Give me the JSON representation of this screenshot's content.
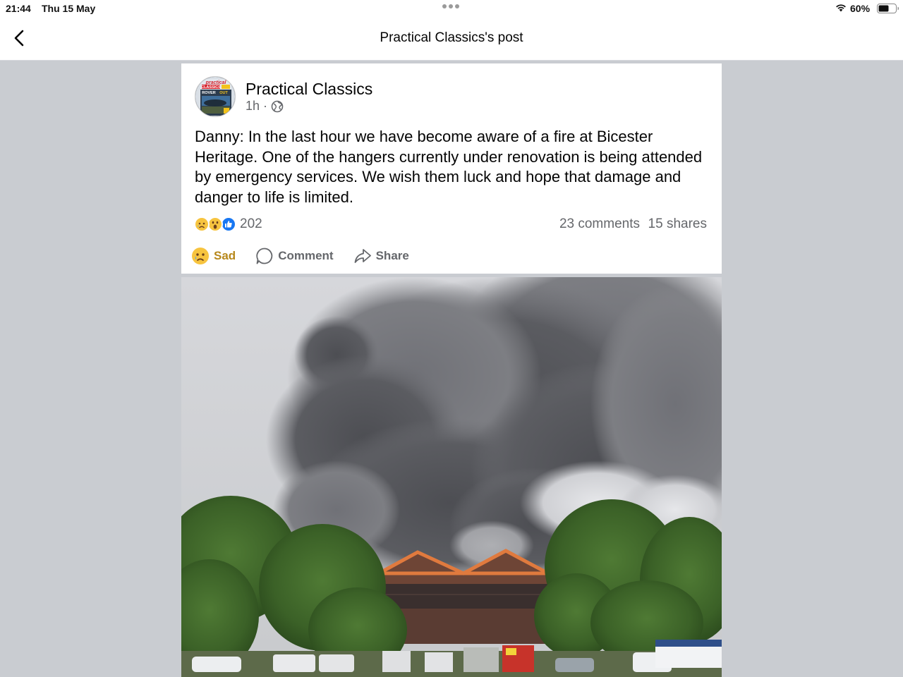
{
  "status_bar": {
    "time": "21:44",
    "date": "Thu 15 May",
    "battery": "60%"
  },
  "header": {
    "title": "Practical Classics's post",
    "back_icon": "chevron-left-icon"
  },
  "post": {
    "author": "Practical Classics",
    "time": "1h",
    "separator": "·",
    "privacy_icon": "globe-icon",
    "text": "Danny: In the last hour we have become aware of a fire at Bicester Heritage.  One of the hangers currently under renovation is being attended by emergency services. We wish them luck and hope that damage and danger to life is limited.",
    "reactions": {
      "icons": [
        "sad-reaction-icon",
        "wow-reaction-icon",
        "like-reaction-icon"
      ],
      "count": "202"
    },
    "comments": "23 comments",
    "shares": "15 shares",
    "actions": {
      "sad_label": "Sad",
      "comment_label": "Comment",
      "share_label": "Share"
    },
    "avatar_text": {
      "line1": "practical",
      "line2": "CLASSICS",
      "line3": "ROVER",
      "line4": "OUT"
    }
  },
  "colors": {
    "sad_accent": "#b7881c",
    "like_blue": "#1877f2",
    "secondary_text": "#65676b",
    "page_bg": "#c9ccd1"
  }
}
